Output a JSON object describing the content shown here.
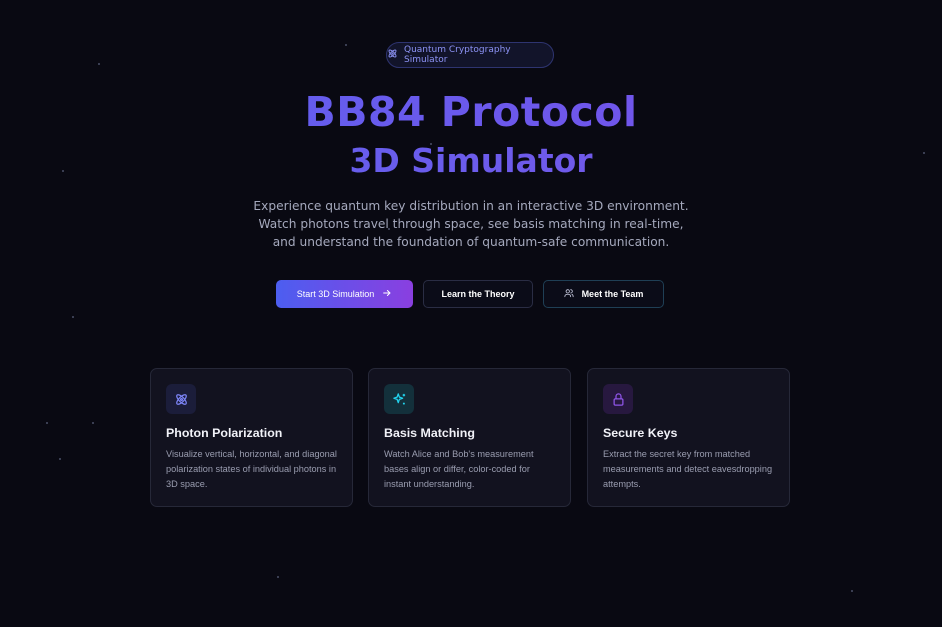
{
  "badge": {
    "label": "Quantum Cryptography Simulator",
    "icon": "atom-icon"
  },
  "hero": {
    "title_line1": "BB84 Protocol",
    "title_line2": "3D Simulator",
    "subtitle": "Experience quantum key distribution in an interactive 3D environment. Watch photons travel through space, see basis matching in real-time, and understand the foundation of quantum-safe communication."
  },
  "actions": {
    "start_label": "Start 3D Simulation",
    "theory_label": "Learn the Theory",
    "team_label": "Meet the Team"
  },
  "features": [
    {
      "title": "Photon Polarization",
      "description": "Visualize vertical, horizontal, and diagonal polarization states of individual photons in 3D space.",
      "icon": "atom-icon"
    },
    {
      "title": "Basis Matching",
      "description": "Watch Alice and Bob's measurement bases align or differ, color-coded for instant understanding.",
      "icon": "sparkles-icon"
    },
    {
      "title": "Secure Keys",
      "description": "Extract the secret key from matched measurements and detect eavesdropping attempts.",
      "icon": "lock-icon"
    }
  ],
  "colors": {
    "background": "#090912",
    "accent_blue": "#5b63f0",
    "accent_purple": "#7a4fe8",
    "cyan": "#22d3ee"
  }
}
